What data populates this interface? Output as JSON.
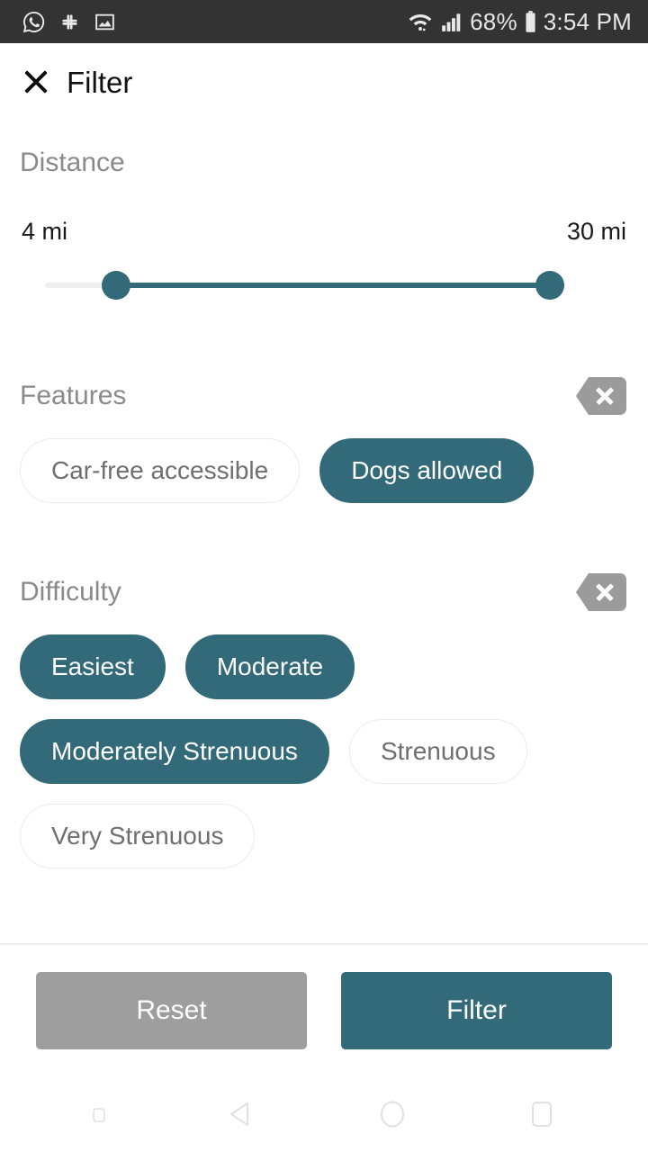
{
  "status_bar": {
    "left_icons": [
      "whatsapp-icon",
      "slack-icon",
      "photo-icon"
    ],
    "wifi_icon": "wifi-icon",
    "signal_icon": "cellular-signal-icon",
    "battery_percent": "68%",
    "battery_icon": "battery-icon",
    "time": "3:54 PM",
    "background_color": "#333333"
  },
  "header": {
    "close_icon": "close-icon",
    "title": "Filter"
  },
  "distance": {
    "title": "Distance",
    "min_label": "4 mi",
    "max_label": "30 mi",
    "slider": {
      "low_value": 4,
      "high_value": 30,
      "accent_color": "#336a79",
      "track_color": "#efefef"
    }
  },
  "features": {
    "title": "Features",
    "clear_icon": "clear-backspace-icon",
    "chips": [
      {
        "label": "Car-free accessible",
        "selected": false
      },
      {
        "label": "Dogs allowed",
        "selected": true
      }
    ]
  },
  "difficulty": {
    "title": "Difficulty",
    "clear_icon": "clear-backspace-icon",
    "chips": [
      {
        "label": "Easiest",
        "selected": true
      },
      {
        "label": "Moderate",
        "selected": true
      },
      {
        "label": "Moderately Strenuous",
        "selected": true
      },
      {
        "label": "Strenuous",
        "selected": false
      },
      {
        "label": "Very Strenuous",
        "selected": false
      }
    ]
  },
  "footer": {
    "reset_label": "Reset",
    "filter_label": "Filter",
    "reset_color": "#9e9e9e",
    "filter_color": "#336a79"
  },
  "navbar": {
    "items": [
      "menu-square-icon",
      "back-triangle-icon",
      "home-circle-icon",
      "recents-square-icon"
    ]
  }
}
